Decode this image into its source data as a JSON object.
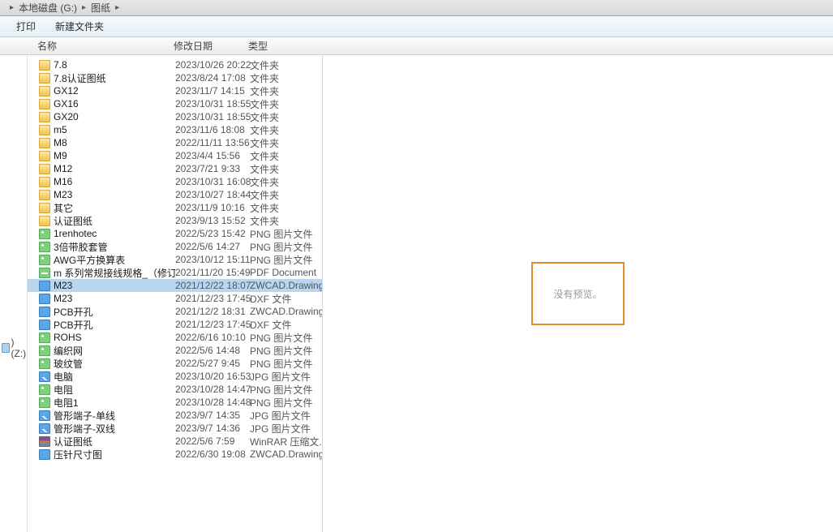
{
  "breadcrumb": {
    "disk": "本地磁盘 (G:)",
    "folder": "图纸"
  },
  "toolbar": {
    "print": "打印",
    "newfolder": "新建文件夹"
  },
  "columns": {
    "name": "名称",
    "date": "修改日期",
    "type": "类型"
  },
  "drive_row": ") (Z:)",
  "preview_text": "没有预览。",
  "files": [
    {
      "icon": "fold",
      "name": "7.8",
      "date": "2023/10/26 20:22",
      "type": "文件夹"
    },
    {
      "icon": "fold",
      "name": "7.8认证图纸",
      "date": "2023/8/24 17:08",
      "type": "文件夹"
    },
    {
      "icon": "fold",
      "name": "GX12",
      "date": "2023/11/7 14:15",
      "type": "文件夹"
    },
    {
      "icon": "fold",
      "name": "GX16",
      "date": "2023/10/31 18:55",
      "type": "文件夹"
    },
    {
      "icon": "fold",
      "name": "GX20",
      "date": "2023/10/31 18:55",
      "type": "文件夹"
    },
    {
      "icon": "fold",
      "name": "m5",
      "date": "2023/11/6 18:08",
      "type": "文件夹"
    },
    {
      "icon": "fold",
      "name": "M8",
      "date": "2022/11/11 13:56",
      "type": "文件夹"
    },
    {
      "icon": "fold",
      "name": "M9",
      "date": "2023/4/4 15:56",
      "type": "文件夹"
    },
    {
      "icon": "fold",
      "name": "M12",
      "date": "2023/7/21 9:33",
      "type": "文件夹"
    },
    {
      "icon": "fold",
      "name": "M16",
      "date": "2023/10/31 16:08",
      "type": "文件夹"
    },
    {
      "icon": "fold",
      "name": "M23",
      "date": "2023/10/27 18:44",
      "type": "文件夹"
    },
    {
      "icon": "fold",
      "name": "其它",
      "date": "2023/11/9 10:16",
      "type": "文件夹"
    },
    {
      "icon": "fold",
      "name": "认证图纸",
      "date": "2023/9/13 15:52",
      "type": "文件夹"
    },
    {
      "icon": "png",
      "name": "1renhotec",
      "date": "2022/5/23 15:42",
      "type": "PNG 图片文件"
    },
    {
      "icon": "png",
      "name": "3倍带胶套管",
      "date": "2022/5/6 14:27",
      "type": "PNG 图片文件"
    },
    {
      "icon": "png",
      "name": "AWG平方换算表",
      "date": "2023/10/12 15:11",
      "type": "PNG 图片文件"
    },
    {
      "icon": "pdf",
      "name": "m 系列常规接线规格_（修订版）",
      "date": "2021/11/20 15:49",
      "type": "PDF Document"
    },
    {
      "icon": "dwg",
      "name": "M23",
      "date": "2021/12/22 18:07",
      "type": "ZWCAD.Drawing",
      "selected": true
    },
    {
      "icon": "dxf",
      "name": "M23",
      "date": "2021/12/23 17:45",
      "type": "DXF 文件"
    },
    {
      "icon": "dwg",
      "name": "PCB开孔",
      "date": "2021/12/2 18:31",
      "type": "ZWCAD.Drawing"
    },
    {
      "icon": "dxf",
      "name": "PCB开孔",
      "date": "2021/12/23 17:45",
      "type": "DXF 文件"
    },
    {
      "icon": "png",
      "name": "ROHS",
      "date": "2022/6/16 10:10",
      "type": "PNG 图片文件"
    },
    {
      "icon": "png",
      "name": "编织网",
      "date": "2022/5/6 14:48",
      "type": "PNG 图片文件"
    },
    {
      "icon": "png",
      "name": "玻纹管",
      "date": "2022/5/27 9:45",
      "type": "PNG 图片文件"
    },
    {
      "icon": "jpg",
      "name": "电脑",
      "date": "2023/10/20 16:53",
      "type": "JPG 图片文件"
    },
    {
      "icon": "png",
      "name": "电阻",
      "date": "2023/10/28 14:47",
      "type": "PNG 图片文件"
    },
    {
      "icon": "png",
      "name": "电阻1",
      "date": "2023/10/28 14:48",
      "type": "PNG 图片文件"
    },
    {
      "icon": "jpg",
      "name": "管形端子-单线",
      "date": "2023/9/7 14:35",
      "type": "JPG 图片文件"
    },
    {
      "icon": "jpg",
      "name": "管形端子-双线",
      "date": "2023/9/7 14:36",
      "type": "JPG 图片文件"
    },
    {
      "icon": "rar",
      "name": "认证图纸",
      "date": "2022/5/6 7:59",
      "type": "WinRAR 压缩文..."
    },
    {
      "icon": "dwg",
      "name": "压针尺寸图",
      "date": "2022/6/30 19:08",
      "type": "ZWCAD.Drawing"
    }
  ]
}
